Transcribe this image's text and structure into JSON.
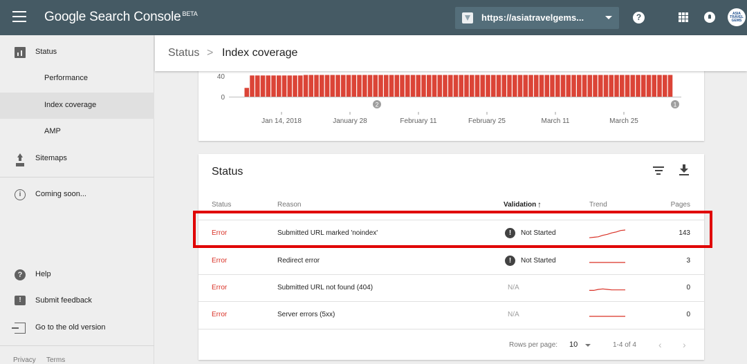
{
  "app": {
    "brand": "Google Search Console",
    "brand_tag": "BETA",
    "property_url": "https://asiatravelgems...",
    "avatar_text": "ASIA TRAVEL GEMS",
    "help_glyph": "?"
  },
  "sidebar": {
    "items": [
      {
        "label": "Status",
        "icon": "bar-chart-icon"
      },
      {
        "label": "Performance"
      },
      {
        "label": "Index coverage"
      },
      {
        "label": "AMP"
      },
      {
        "label": "Sitemaps",
        "icon": "upload-icon"
      },
      {
        "label": "Coming soon...",
        "icon": "info-icon"
      }
    ],
    "bottom": [
      {
        "label": "Help",
        "icon": "help-icon"
      },
      {
        "label": "Submit feedback",
        "icon": "feedback-icon"
      },
      {
        "label": "Go to the old version",
        "icon": "exit-icon"
      }
    ],
    "footer": {
      "privacy": "Privacy",
      "terms": "Terms"
    }
  },
  "header": {
    "breadcrumb_parent": "Status",
    "breadcrumb_separator": ">",
    "breadcrumb_current": "Index coverage"
  },
  "chart_data": {
    "type": "bar",
    "y_ticks": [
      "40",
      "0"
    ],
    "x_tick_labels": [
      "Jan 14, 2018",
      "January 28",
      "February 11",
      "February 25",
      "March 11",
      "March 25"
    ],
    "annotations": [
      "2",
      "1"
    ],
    "bar_color": "#db4437",
    "values": [
      17,
      41,
      41,
      41,
      41,
      41,
      41,
      41,
      41,
      41,
      41,
      42,
      42,
      42,
      42,
      42,
      42,
      42,
      42,
      42,
      42,
      42,
      42,
      42,
      42,
      42,
      42,
      42,
      42,
      42,
      42,
      42,
      42,
      42,
      42,
      42,
      42,
      42,
      42,
      42,
      42,
      42,
      42,
      42,
      42,
      42,
      42,
      42,
      42,
      42,
      42,
      42,
      42,
      42,
      42,
      42,
      42,
      42,
      42,
      42,
      42,
      42,
      42,
      42,
      42,
      42,
      42,
      42,
      42,
      42,
      42,
      42,
      42,
      42,
      42,
      42,
      42,
      42,
      42,
      42
    ]
  },
  "status_table": {
    "title": "Status",
    "columns": {
      "status": "Status",
      "reason": "Reason",
      "validation": "Validation",
      "validation_sort": "↑",
      "trend": "Trend",
      "pages": "Pages"
    },
    "rows": [
      {
        "status": "Error",
        "reason": "Submitted URL marked 'noindex'",
        "validation": "Not Started",
        "validation_icon": "!",
        "pages": "143",
        "trend": [
          0.2,
          0.25,
          0.3,
          0.45,
          0.55,
          0.7,
          0.8,
          0.95,
          1.0
        ]
      },
      {
        "status": "Error",
        "reason": "Redirect error",
        "validation": "Not Started",
        "validation_icon": "!",
        "pages": "3",
        "trend": [
          0.5,
          0.5,
          0.5,
          0.5,
          0.5,
          0.5,
          0.5,
          0.5,
          0.5
        ]
      },
      {
        "status": "Error",
        "reason": "Submitted URL not found (404)",
        "validation": "N/A",
        "pages": "0",
        "trend": [
          0.4,
          0.4,
          0.5,
          0.55,
          0.5,
          0.45,
          0.45,
          0.45,
          0.45
        ]
      },
      {
        "status": "Error",
        "reason": "Server errors (5xx)",
        "validation": "N/A",
        "pages": "0",
        "trend": [
          0.5,
          0.5,
          0.5,
          0.5,
          0.5,
          0.5,
          0.5,
          0.5,
          0.5
        ]
      }
    ],
    "pagination": {
      "rows_per_page_label": "Rows per page:",
      "rows_per_page": "10",
      "range": "1-4 of 4",
      "prev": "‹",
      "next": "›"
    }
  },
  "colors": {
    "topbar": "#455a64",
    "error": "#d93025",
    "highlight": "#e00000"
  }
}
